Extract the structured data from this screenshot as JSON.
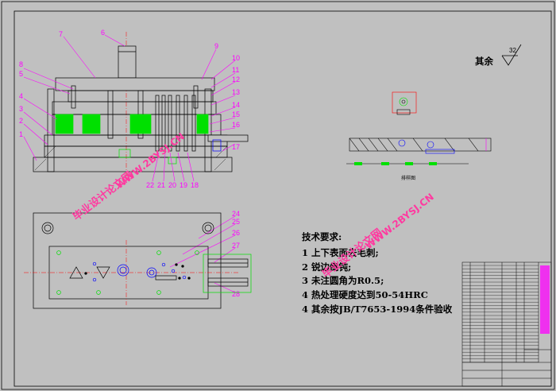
{
  "colors": {
    "background": "#c0c0c0",
    "outline": "#000000",
    "leader": "#ff00ff",
    "center_line": "#ff0000",
    "accent_green": "#00e000",
    "hole_blue": "#0000ff",
    "watermark": "#ff3aa0"
  },
  "part_numbers": {
    "left": [
      "8",
      "5",
      "4",
      "3",
      "2",
      "1"
    ],
    "top": [
      "7",
      "6"
    ],
    "right": [
      "9",
      "10",
      "11",
      "12",
      "13",
      "14",
      "15",
      "16",
      "17"
    ],
    "bottom": [
      "22",
      "21",
      "20",
      "19",
      "18"
    ],
    "plan": [
      "24",
      "25",
      "26",
      "27",
      "28"
    ]
  },
  "roughness": {
    "prefix": "其余",
    "value": "32"
  },
  "strip_caption": "排样图",
  "technical_requirements": {
    "title": "技术要求:",
    "items": [
      {
        "n": "1",
        "text": "上下表面去毛刺;"
      },
      {
        "n": "2",
        "text": "锐边倒钝;"
      },
      {
        "n": "3",
        "text": "未注圆角为R0.5;"
      },
      {
        "n": "4",
        "text": "热处理硬度达到50-54HRC"
      },
      {
        "n": "4",
        "text": "其余按JB/T7653-1994条件验收"
      }
    ]
  },
  "watermarks": {
    "site_cn": "毕业设计论文网",
    "site_url": "WWW.2BYSJ.CN"
  }
}
